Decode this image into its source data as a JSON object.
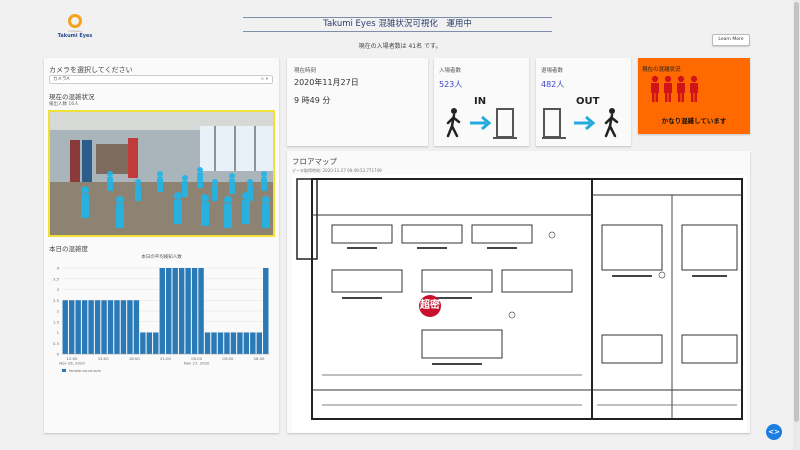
{
  "header": {
    "logo_sub": "company",
    "logo_name": "Takumi Eyes",
    "title": "Takumi Eyes 混雑状況可視化　運用中",
    "current_visitors_text": "現在の入場者数は 41名 です。",
    "learn_more_label": "Learn More"
  },
  "camera": {
    "select_label": "カメラを選択してください",
    "select_value": "カメラA",
    "status_heading": "現在の混雑状況",
    "detected_count": "検出人数 16人"
  },
  "chart_section": {
    "heading": "本日の混雑度"
  },
  "time_card": {
    "label": "現在時刻",
    "date": "2020年11月27日",
    "time": "9 時49 分"
  },
  "entry_card": {
    "label": "入場者数",
    "value": "523人",
    "word": "IN"
  },
  "exit_card": {
    "label": "退場者数",
    "value": "482人",
    "word": "OUT"
  },
  "crowd_card": {
    "label": "現在の混雑状況",
    "message": "かなり混雑しています",
    "color": "#ff6a00"
  },
  "floor_map": {
    "label": "フロアマップ",
    "timestamp": "データ取得時刻: 2020-11-27 09:49:53.771749",
    "stamp_text": "超密"
  },
  "chart_data": {
    "type": "bar",
    "title": "本日の平均検知人数",
    "legend": "female-count-sum",
    "x_tick_labels": [
      "12:00\nNov 26, 2020",
      "15:00",
      "18:00",
      "21:00",
      "00:00\nNov 27, 2020",
      "03:00",
      "06:00"
    ],
    "ylim": [
      0,
      4
    ],
    "y_ticks": [
      "0",
      "0.5",
      "1",
      "1.5",
      "2",
      "2.5",
      "3",
      "3.5",
      "4"
    ],
    "values": [
      2.5,
      2.5,
      2.5,
      2.5,
      2.5,
      2.5,
      2.5,
      2.5,
      2.5,
      2.5,
      2.5,
      2.5,
      1,
      1,
      1,
      4,
      4,
      4,
      4,
      4,
      4,
      4,
      1,
      1,
      1,
      1,
      1,
      1,
      1,
      1,
      1,
      4
    ],
    "color": "#2a7ab8"
  },
  "accent": "#1c7fe0"
}
